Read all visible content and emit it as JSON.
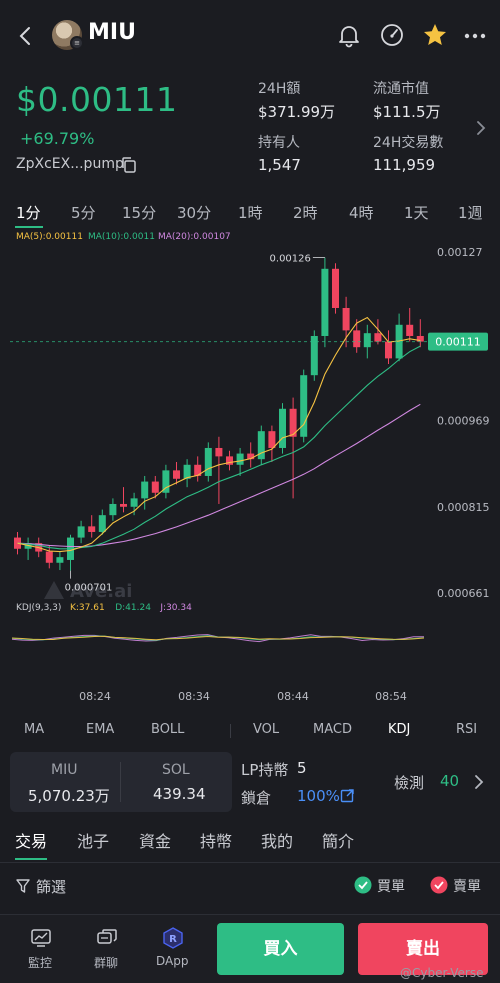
{
  "header": {
    "title": "MIU",
    "back_icon": "chevron-left-icon",
    "bell_icon": "bell-icon",
    "gauge_icon": "gauge-icon",
    "star_icon": "star-icon",
    "more_icon": "more-icon"
  },
  "token": {
    "price": "$0.00111",
    "change": "+69.79%",
    "address": "ZpXcEX...pump"
  },
  "stats": [
    {
      "label": "24H額",
      "value": "$371.99万"
    },
    {
      "label": "流通市值",
      "value": "$111.5万"
    },
    {
      "label": "持有人",
      "value": "1,547"
    },
    {
      "label": "24H交易數",
      "value": "111,959"
    }
  ],
  "timeframes": [
    "1分",
    "5分",
    "15分",
    "30分",
    "1時",
    "2時",
    "4時",
    "1天",
    "1週"
  ],
  "ma_legend": [
    {
      "text": "MA(5):0.00111",
      "color": "#f5c242"
    },
    {
      "text": "MA(10):0.0011",
      "color": "#2ebd85"
    },
    {
      "text": "MA(20):0.00107",
      "color": "#d088e0"
    }
  ],
  "chart_data": {
    "type": "candlestick",
    "y_ticks": [
      "0.00127",
      "0.000969",
      "0.000815",
      "0.000661"
    ],
    "x_ticks": [
      "08:24",
      "08:34",
      "08:44",
      "08:54"
    ],
    "current_price_label": "0.00111",
    "high_label": "0.00126",
    "low_label": "0.000701",
    "watermark": "Ave.ai",
    "kdj_label": "KDJ(9,3,3)",
    "kdj": [
      {
        "text": "K:37.61",
        "color": "#f5c242"
      },
      {
        "text": "D:41.24",
        "color": "#2ebd85"
      },
      {
        "text": "J:30.34",
        "color": "#d088e0"
      }
    ],
    "candles": [
      {
        "o": 0.00076,
        "h": 0.00077,
        "l": 0.00073,
        "c": 0.00074
      },
      {
        "o": 0.00074,
        "h": 0.00076,
        "l": 0.00072,
        "c": 0.00075
      },
      {
        "o": 0.00075,
        "h": 0.00076,
        "l": 0.000725,
        "c": 0.000735
      },
      {
        "o": 0.000735,
        "h": 0.000745,
        "l": 0.000705,
        "c": 0.000715
      },
      {
        "o": 0.000715,
        "h": 0.000735,
        "l": 0.000702,
        "c": 0.000725
      },
      {
        "o": 0.00072,
        "h": 0.000765,
        "l": 0.000701,
        "c": 0.00076
      },
      {
        "o": 0.00076,
        "h": 0.00079,
        "l": 0.00075,
        "c": 0.00078
      },
      {
        "o": 0.00078,
        "h": 0.0008,
        "l": 0.00076,
        "c": 0.00077
      },
      {
        "o": 0.00077,
        "h": 0.00081,
        "l": 0.000765,
        "c": 0.0008
      },
      {
        "o": 0.0008,
        "h": 0.00083,
        "l": 0.00079,
        "c": 0.00082
      },
      {
        "o": 0.00082,
        "h": 0.00085,
        "l": 0.000805,
        "c": 0.000815
      },
      {
        "o": 0.000815,
        "h": 0.00084,
        "l": 0.0008,
        "c": 0.00083
      },
      {
        "o": 0.00083,
        "h": 0.00087,
        "l": 0.00081,
        "c": 0.00086
      },
      {
        "o": 0.00086,
        "h": 0.00087,
        "l": 0.00083,
        "c": 0.00084
      },
      {
        "o": 0.00084,
        "h": 0.00089,
        "l": 0.00083,
        "c": 0.00088
      },
      {
        "o": 0.00088,
        "h": 0.000895,
        "l": 0.000855,
        "c": 0.000865
      },
      {
        "o": 0.000865,
        "h": 0.0009,
        "l": 0.00085,
        "c": 0.00089
      },
      {
        "o": 0.00089,
        "h": 0.000905,
        "l": 0.00086,
        "c": 0.00087
      },
      {
        "o": 0.00087,
        "h": 0.00093,
        "l": 0.00086,
        "c": 0.00092
      },
      {
        "o": 0.00092,
        "h": 0.00094,
        "l": 0.00082,
        "c": 0.000905
      },
      {
        "o": 0.000905,
        "h": 0.000915,
        "l": 0.00088,
        "c": 0.00089
      },
      {
        "o": 0.00089,
        "h": 0.00092,
        "l": 0.00087,
        "c": 0.00091
      },
      {
        "o": 0.00091,
        "h": 0.00093,
        "l": 0.000885,
        "c": 0.0009
      },
      {
        "o": 0.0009,
        "h": 0.00096,
        "l": 0.00089,
        "c": 0.00095
      },
      {
        "o": 0.00095,
        "h": 0.00096,
        "l": 0.000895,
        "c": 0.00092
      },
      {
        "o": 0.00092,
        "h": 0.001,
        "l": 0.00091,
        "c": 0.00099
      },
      {
        "o": 0.00099,
        "h": 0.00101,
        "l": 0.00083,
        "c": 0.00094
      },
      {
        "o": 0.00094,
        "h": 0.00106,
        "l": 0.00093,
        "c": 0.00105
      },
      {
        "o": 0.00105,
        "h": 0.00113,
        "l": 0.00104,
        "c": 0.00112
      },
      {
        "o": 0.00112,
        "h": 0.00126,
        "l": 0.0011,
        "c": 0.00124
      },
      {
        "o": 0.00124,
        "h": 0.00125,
        "l": 0.00116,
        "c": 0.00117
      },
      {
        "o": 0.00117,
        "h": 0.00119,
        "l": 0.0011,
        "c": 0.00113
      },
      {
        "o": 0.00113,
        "h": 0.00115,
        "l": 0.00109,
        "c": 0.0011
      },
      {
        "o": 0.0011,
        "h": 0.00114,
        "l": 0.00108,
        "c": 0.001125
      },
      {
        "o": 0.001125,
        "h": 0.00115,
        "l": 0.001105,
        "c": 0.00111
      },
      {
        "o": 0.00111,
        "h": 0.00113,
        "l": 0.00107,
        "c": 0.00108
      },
      {
        "o": 0.00108,
        "h": 0.00116,
        "l": 0.001075,
        "c": 0.00114
      },
      {
        "o": 0.00114,
        "h": 0.00117,
        "l": 0.00111,
        "c": 0.00112
      },
      {
        "o": 0.00112,
        "h": 0.00115,
        "l": 0.0011,
        "c": 0.00111
      }
    ],
    "ma5": [
      0.00075,
      0.000746,
      0.000742,
      0.000736,
      0.000735,
      0.000737,
      0.000743,
      0.00075,
      0.000767,
      0.000786,
      0.000797,
      0.000807,
      0.000825,
      0.000833,
      0.000849,
      0.000858,
      0.000867,
      0.000871,
      0.000883,
      0.00089,
      0.000894,
      0.000897,
      0.000901,
      0.000911,
      0.000918,
      0.000938,
      0.000944,
      0.000962,
      0.001002,
      0.001052,
      0.001086,
      0.001117,
      0.001143,
      0.001153,
      0.001132,
      0.001109,
      0.001111,
      0.001115,
      0.001112
    ],
    "ma10": [
      0.00075,
      0.000748,
      0.000746,
      0.000742,
      0.00074,
      0.00074,
      0.000742,
      0.000744,
      0.00075,
      0.000758,
      0.000766,
      0.000775,
      0.000787,
      0.000798,
      0.000811,
      0.000822,
      0.000833,
      0.000841,
      0.00085,
      0.00086,
      0.000867,
      0.000874,
      0.000882,
      0.00089,
      0.000897,
      0.000905,
      0.000912,
      0.000922,
      0.000939,
      0.00096,
      0.000978,
      0.000996,
      0.001014,
      0.001032,
      0.001048,
      0.001062,
      0.001078,
      0.001092,
      0.001102
    ],
    "ma20": [
      0.00075,
      0.000749,
      0.000748,
      0.000746,
      0.000745,
      0.000744,
      0.000744,
      0.000745,
      0.000747,
      0.00075,
      0.000753,
      0.000757,
      0.000762,
      0.000767,
      0.000773,
      0.000779,
      0.000786,
      0.000793,
      0.0008,
      0.000808,
      0.000816,
      0.000824,
      0.000832,
      0.00084,
      0.000848,
      0.000856,
      0.000864,
      0.000873,
      0.000883,
      0.000895,
      0.000906,
      0.000917,
      0.000928,
      0.00094,
      0.000952,
      0.000963,
      0.000975,
      0.000987,
      0.000998
    ]
  },
  "indicators": [
    "MA",
    "EMA",
    "BOLL",
    "VOL",
    "MACD",
    "KDJ",
    "RSI"
  ],
  "pool": {
    "base_name": "MIU",
    "base_amount": "5,070.23万",
    "quote_name": "SOL",
    "quote_amount": "439.34",
    "lp_label": "LP持幣",
    "lp_value": "5",
    "lock_label": "鎖倉",
    "lock_value": "100%",
    "check_label": "檢測",
    "check_value": "40"
  },
  "main_tabs": [
    "交易",
    "池子",
    "資金",
    "持幣",
    "我的",
    "簡介"
  ],
  "filter": {
    "label": "篩選",
    "buy_label": "買單",
    "sell_label": "賣單"
  },
  "bottom_nav": [
    {
      "label": "監控",
      "icon": "monitor-icon"
    },
    {
      "label": "群聊",
      "icon": "chat-icon"
    },
    {
      "label": "DApp",
      "icon": "dapp-icon"
    }
  ],
  "actions": {
    "buy": "買入",
    "sell": "賣出"
  },
  "watermark": "@Cyber-Verse",
  "colors": {
    "up": "#2ebd85",
    "down": "#f0455f",
    "accent": "#2ebd85",
    "star": "#f5c242"
  }
}
